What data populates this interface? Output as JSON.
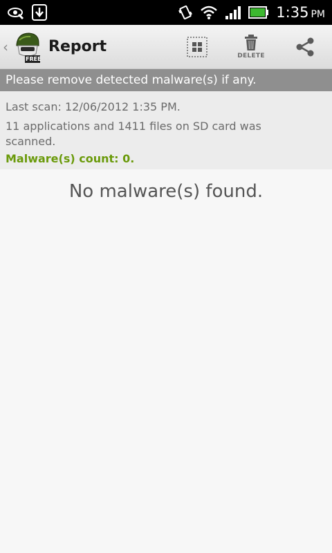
{
  "status_bar": {
    "time": "1:35",
    "ampm": "PM",
    "icons": [
      "eye-notification-icon",
      "download-notification-icon",
      "vibrate-icon",
      "wifi-icon",
      "signal-icon",
      "battery-icon"
    ],
    "battery_color": "#3db830"
  },
  "action_bar": {
    "title": "Report",
    "logo_badge": "FREE",
    "actions": [
      {
        "icon": "select-all-icon",
        "label": ""
      },
      {
        "icon": "trash-icon",
        "label": "DELETE"
      },
      {
        "icon": "share-icon",
        "label": ""
      }
    ]
  },
  "banner": {
    "text": "Please remove detected malware(s) if any."
  },
  "summary": {
    "last_scan": "Last scan: 12/06/2012 1:35 PM.",
    "scanned_line1": "11 applications and 1411 files on SD card was",
    "scanned_line2": "scanned.",
    "malware_count": "Malware(s) count: 0.",
    "count_color": "#6a9a0a"
  },
  "main": {
    "message": "No malware(s) found."
  }
}
